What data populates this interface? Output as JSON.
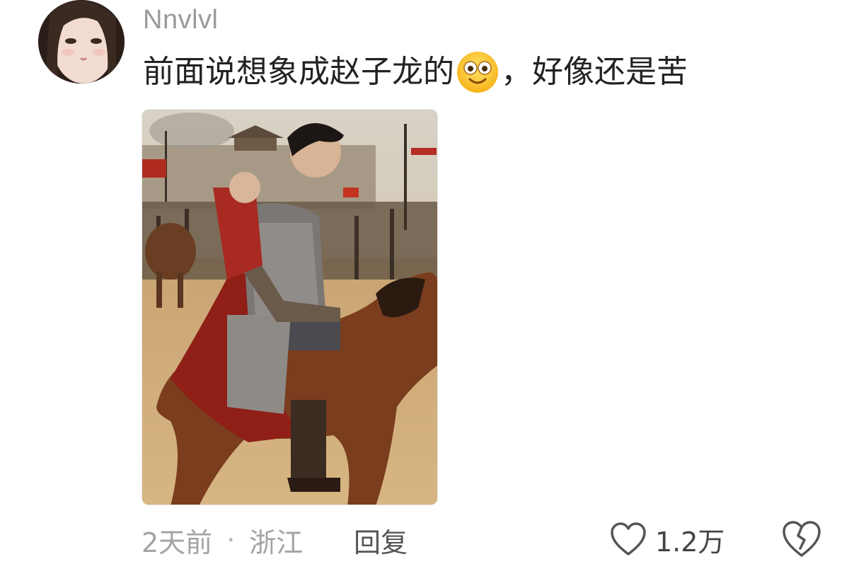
{
  "comment": {
    "username": "Nnvlvl",
    "text_before_emoji": "前面说想象成赵子龙的",
    "emoji": "smiley-emoji",
    "text_after_emoji": "，好像还是苦",
    "time": "2天前",
    "separator": "·",
    "location": "浙江",
    "reply_label": "回复",
    "like_count": "1.2万"
  },
  "icons": {
    "like": "heart-outline-icon",
    "dislike": "broken-heart-icon"
  },
  "colors": {
    "username": "#9a9a9a",
    "text": "#222222",
    "meta": "#a3a3a3",
    "reply": "#555555"
  }
}
